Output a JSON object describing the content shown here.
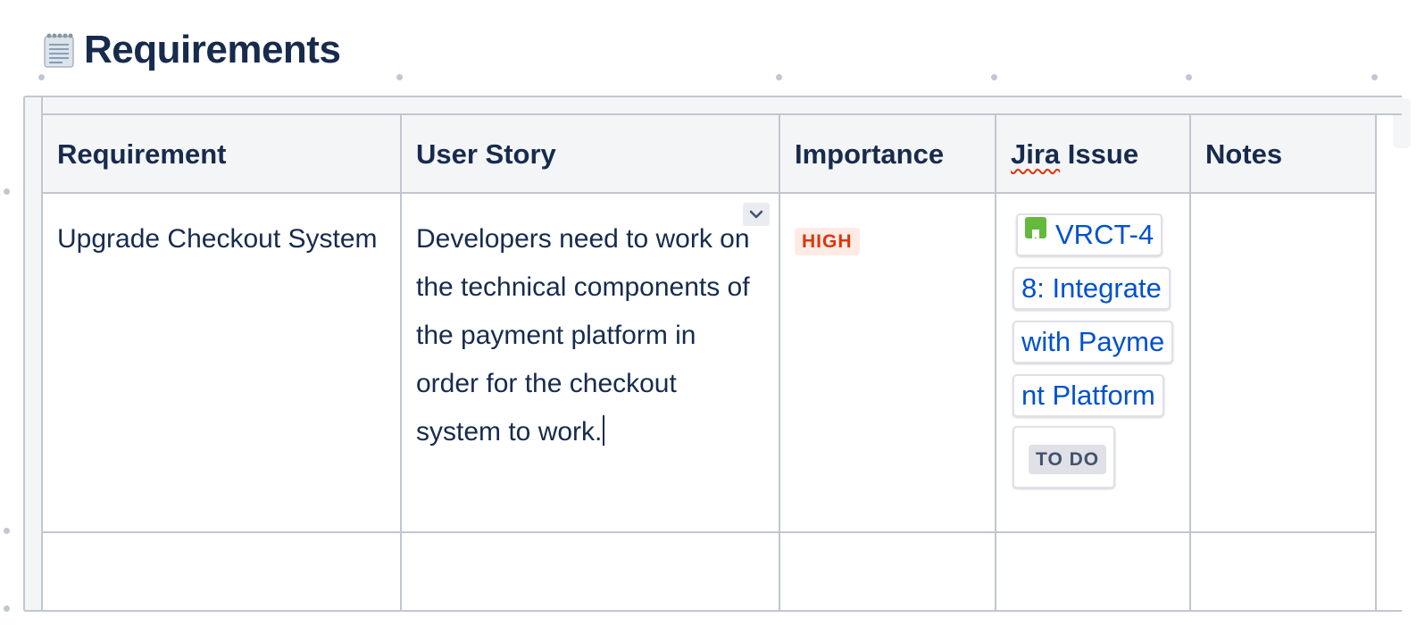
{
  "page": {
    "heading": "Requirements",
    "heading_icon": "notepad-icon"
  },
  "table": {
    "headers": [
      "Requirement",
      "User Story",
      "Importance",
      "Jira Issue",
      "Notes"
    ],
    "rows": [
      {
        "requirement": "Upgrade Checkout System",
        "user_story": "Developers need to work on the technical components of the payment platform in order for the checkout system to work.",
        "importance": "HIGH",
        "jira_issue": {
          "lines": [
            "VRCT-4",
            "8: Integrate",
            "with Payme",
            "nt Platform"
          ],
          "key_and_title": "VRCT-48: Integrate with Payment Platform",
          "status": "TO DO",
          "icon": "story-icon"
        },
        "notes": ""
      },
      {
        "requirement": "",
        "user_story": "",
        "importance": "",
        "jira_issue": null,
        "notes": ""
      }
    ]
  },
  "colors": {
    "text": "#172b4d",
    "link": "#0052cc",
    "high_bg": "#ffebe6",
    "high_text": "#de350b",
    "todo_bg": "#dfe1e6",
    "border": "#c1c7d0",
    "header_bg": "#f4f5f7"
  }
}
